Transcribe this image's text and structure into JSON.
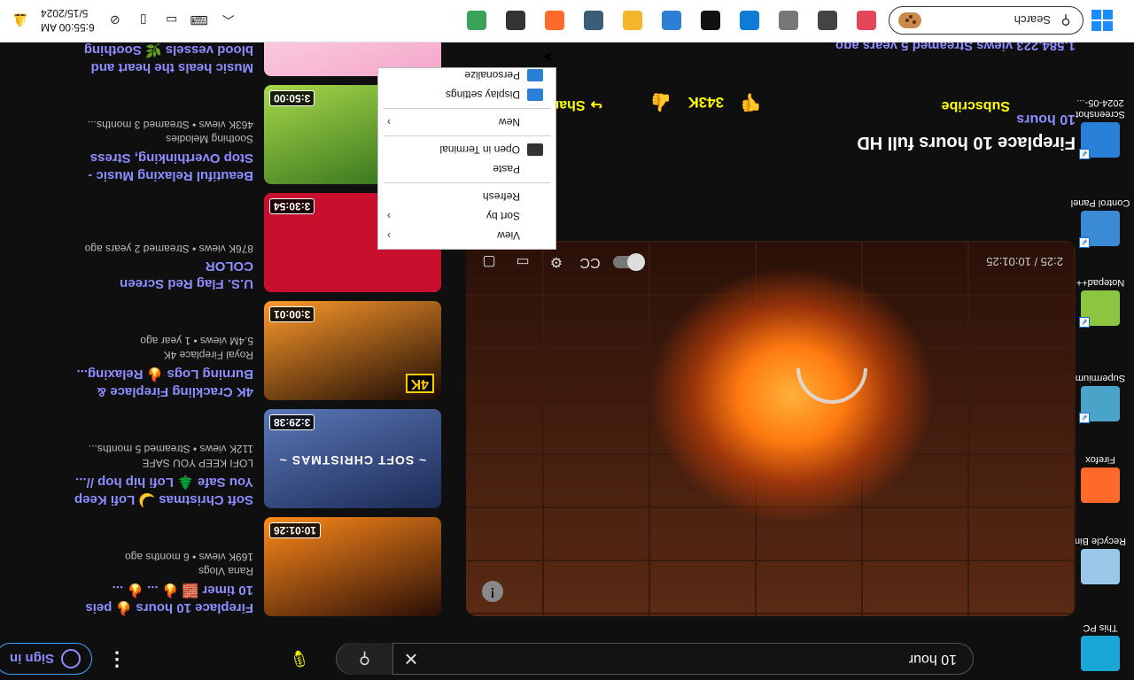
{
  "taskbar": {
    "search_label": "Search",
    "date": "5/15/2024",
    "time": "6:55:00 AM",
    "apps": [
      {
        "name": "copilot",
        "icon": "copilot-icon",
        "color": "#e3455a"
      },
      {
        "name": "task-view",
        "icon": "task-view-icon",
        "color": "#444"
      },
      {
        "name": "discord-like",
        "icon": "chat-icon",
        "color": "#777"
      },
      {
        "name": "edge",
        "icon": "edge-icon",
        "color": "#0f7bd6"
      },
      {
        "name": "capture",
        "icon": "capture-icon",
        "color": "#111"
      },
      {
        "name": "remote",
        "icon": "remote-desktop-icon",
        "color": "#2c7ed6"
      },
      {
        "name": "explorer",
        "icon": "folder-icon",
        "color": "#f3b52a"
      },
      {
        "name": "steam",
        "icon": "steam-icon",
        "color": "#3a5e7a"
      },
      {
        "name": "firefox",
        "icon": "firefox-icon",
        "color": "#ff6a2b"
      },
      {
        "name": "notes",
        "icon": "notes-icon",
        "color": "#333"
      },
      {
        "name": "chart",
        "icon": "chart-app-icon",
        "color": "#3aa35a"
      }
    ]
  },
  "desktop": {
    "icons": [
      {
        "label": "This PC",
        "icon": "this-pc-icon",
        "color": "#1aa6d6"
      },
      {
        "label": "Recycle Bin",
        "icon": "recycle-bin-icon",
        "color": "#9bc8e8"
      },
      {
        "label": "Firefox",
        "icon": "firefox-icon",
        "color": "#ff6a2b"
      },
      {
        "label": "Supermium",
        "icon": "supermium-icon",
        "color": "#4aa3c8"
      },
      {
        "label": "Notepad++",
        "icon": "notepad-plus-icon",
        "color": "#8cc640"
      },
      {
        "label": "Control Panel",
        "icon": "control-panel-icon",
        "color": "#3a8ad6"
      },
      {
        "label": "Screenshot 2024-05-...",
        "icon": "screenshot-file-icon",
        "color": "#2a7fd6"
      }
    ]
  },
  "youtube": {
    "search_query": "10 hour",
    "sign_in_label": "Sign in",
    "video": {
      "title": "Fireplace 10 hours full HD",
      "subtitle": "Fireplace 10 hours",
      "description": "1,584,223 views  Streamed 5 years ago",
      "time_display": "2:25 / 10:01:25",
      "subscribe_label": "Subscribe",
      "likes": "343K",
      "share_label": "Share"
    },
    "recommendations": [
      {
        "title": "Fireplace 10 hours 🔥 peis 10 timer 🧱 🔥 ... 🔥 ...",
        "channel": "Rana Vlogs",
        "views": "169K views",
        "age": "6 months ago",
        "duration": "10:01:26",
        "thumb_colors": [
          "#2a0e06",
          "#ff8a1a"
        ]
      },
      {
        "title": "Soft Christmas 🌙 Lofi Keep You Safe 🌲 Lofi hip hop //...",
        "channel": "LOFI KEEP YOU SAFE",
        "views": "112K views",
        "age": "Streamed 5 months...",
        "duration": "3:29:38",
        "thumb_colors": [
          "#1c2a55",
          "#5a78b8"
        ],
        "caption": "~ SOFT CHRISTMAS ~"
      },
      {
        "title": "4K Crackling Fireplace & Burning Logs 🔥 Relaxing...",
        "channel": "Royal Fireplace 4K",
        "views": "5.4M views",
        "age": "1 year ago",
        "duration": "3:00:01",
        "thumb_colors": [
          "#1a0a04",
          "#ff9a2a"
        ],
        "badge": "4K"
      },
      {
        "title": "U.S. Flag Red Screen COLOR",
        "channel": "",
        "views": "876K views",
        "age": "Streamed 2 years ago",
        "duration": "3:30:54",
        "thumb_colors": [
          "#c8102e",
          "#c8102e"
        ]
      },
      {
        "title": "Beautiful Relaxing Music - Stop Overthinking, Stress Relief...",
        "channel": "Soothing Melodies",
        "views": "463K views",
        "age": "Streamed 3 months...",
        "duration": "3:50:00",
        "thumb_colors": [
          "#2a6a18",
          "#a8d84a"
        ]
      },
      {
        "title": "Music heals the heart and blood vessels 🌿 Soothing music",
        "channel": "",
        "views": "",
        "age": "",
        "duration": "",
        "thumb_colors": [
          "#f4a6c8",
          "#ffe0ee"
        ]
      }
    ]
  },
  "context_menu": {
    "items": [
      {
        "label": "View",
        "has_submenu": true,
        "icon": ""
      },
      {
        "label": "Sort by",
        "has_submenu": true,
        "icon": ""
      },
      {
        "label": "Refresh",
        "has_submenu": false,
        "icon": ""
      },
      {
        "separator": true
      },
      {
        "label": "Paste",
        "has_submenu": false,
        "icon": ""
      },
      {
        "label": "Open in Terminal",
        "has_submenu": false,
        "icon": "terminal-icon"
      },
      {
        "separator": true
      },
      {
        "label": "New",
        "has_submenu": true,
        "icon": ""
      },
      {
        "separator": true
      },
      {
        "label": "Display settings",
        "has_submenu": false,
        "icon": "display-icon"
      },
      {
        "label": "Personalize",
        "has_submenu": false,
        "icon": "personalize-icon"
      }
    ]
  }
}
